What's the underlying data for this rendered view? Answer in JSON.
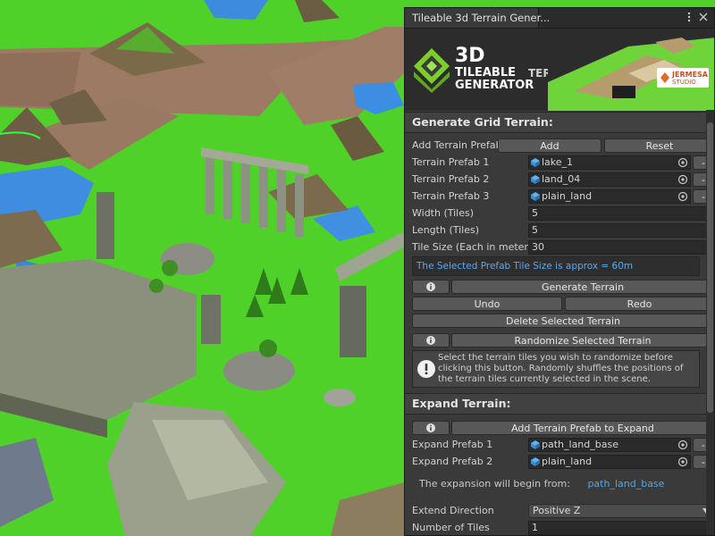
{
  "window": {
    "title": "Tileable 3d Terrain Gener..."
  },
  "banner": {
    "line1": "3D",
    "line2a": "TILEABLE",
    "line2b": "TERRAIN",
    "line3": "GENERATOR",
    "studio_name": "JERMESA",
    "studio_sub": "STUDIO"
  },
  "grid_section": {
    "header": "Generate Grid Terrain:",
    "add_prefab_label": "Add Terrain Prefab:",
    "add_button": "Add",
    "reset_button": "Reset",
    "prefabs": [
      {
        "label": "Terrain Prefab 1",
        "value": "lake_1"
      },
      {
        "label": "Terrain Prefab 2",
        "value": "land_04"
      },
      {
        "label": "Terrain Prefab 3",
        "value": "plain_land"
      }
    ],
    "remove_button": "-",
    "width_label": "Width (Tiles)",
    "width_value": "5",
    "length_label": "Length (Tiles)",
    "length_value": "5",
    "tile_size_label": "Tile Size (Each in meter)",
    "tile_size_value": "30",
    "tile_size_note": "The Selected Prefab Tile Size is approx = 60m",
    "generate_button": "Generate Terrain",
    "undo_button": "Undo",
    "redo_button": "Redo",
    "delete_button": "Delete Selected Terrain",
    "randomize_button": "Randomize Selected Terrain",
    "help_text": "Select the terrain tiles you wish to randomize before clicking this button. Randomly shuffles the positions of the terrain tiles currently selected in the scene."
  },
  "expand_section": {
    "header": "Expand Terrain:",
    "add_button": "Add Terrain Prefab to Expand",
    "prefabs": [
      {
        "label": "Expand Prefab 1",
        "value": "path_land_base"
      },
      {
        "label": "Expand Prefab 2",
        "value": "plain_land"
      }
    ],
    "begin_text": "The expansion will begin from:",
    "begin_link": "path_land_base",
    "direction_label": "Extend Direction",
    "direction_value": "Positive Z",
    "tiles_label": "Number of Tiles",
    "tiles_value": "1"
  },
  "icons": {
    "info": "info-icon",
    "warning": "warning-icon",
    "object": "prefab-cube-icon",
    "picker": "object-picker-icon",
    "menu": "kebab-menu-icon",
    "close": "close-icon"
  },
  "colors": {
    "grass": "#4fd12a",
    "panel_bg": "#3a3a3a",
    "link": "#4fa8f0",
    "accent_green": "#7ccf2a"
  }
}
